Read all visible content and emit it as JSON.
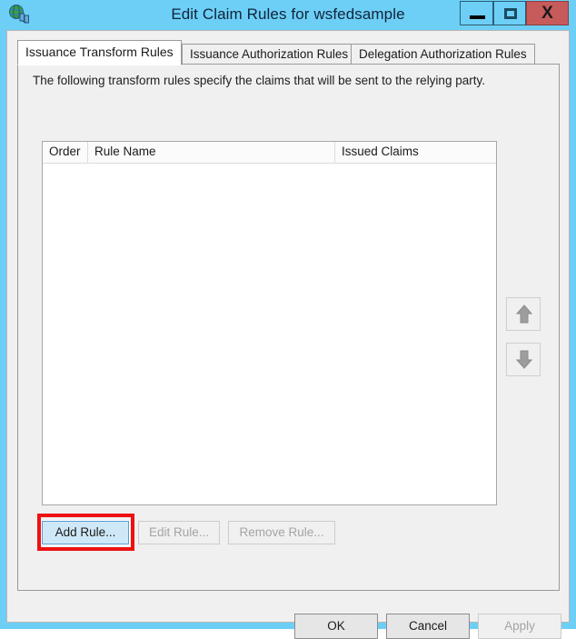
{
  "window": {
    "title": "Edit Claim Rules for wsfedsample",
    "icon": "adfs-globe-icon",
    "controls": {
      "minimize": "–",
      "maximize": "□",
      "close": "X"
    },
    "frame_color": "#6dcff6",
    "close_color": "#c75b5b"
  },
  "tabs": [
    {
      "label": "Issuance Transform Rules",
      "active": true
    },
    {
      "label": "Issuance Authorization Rules",
      "active": false
    },
    {
      "label": "Delegation Authorization Rules",
      "active": false
    }
  ],
  "panel": {
    "description": "The following transform rules specify the claims that will be sent to the relying party."
  },
  "rules_list": {
    "columns": [
      "Order",
      "Rule Name",
      "Issued Claims"
    ],
    "rows": []
  },
  "reorder": {
    "move_up": "move-up-arrow",
    "move_down": "move-down-arrow"
  },
  "rule_actions": {
    "add": "Add Rule...",
    "edit": "Edit Rule...",
    "remove": "Remove Rule..."
  },
  "annotation": {
    "highlight_color": "#ee1111",
    "target": "Add Rule..."
  },
  "footer": {
    "ok": "OK",
    "cancel": "Cancel",
    "apply": "Apply"
  }
}
